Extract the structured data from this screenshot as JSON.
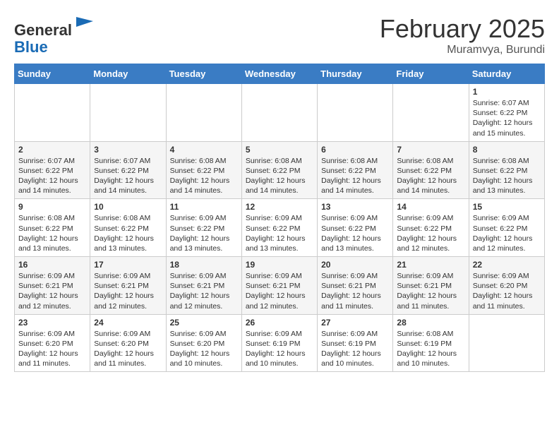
{
  "header": {
    "logo_line1": "General",
    "logo_line2": "Blue",
    "month": "February 2025",
    "location": "Muramvya, Burundi"
  },
  "weekdays": [
    "Sunday",
    "Monday",
    "Tuesday",
    "Wednesday",
    "Thursday",
    "Friday",
    "Saturday"
  ],
  "weeks": [
    [
      {
        "day": "",
        "info": ""
      },
      {
        "day": "",
        "info": ""
      },
      {
        "day": "",
        "info": ""
      },
      {
        "day": "",
        "info": ""
      },
      {
        "day": "",
        "info": ""
      },
      {
        "day": "",
        "info": ""
      },
      {
        "day": "1",
        "info": "Sunrise: 6:07 AM\nSunset: 6:22 PM\nDaylight: 12 hours\nand 15 minutes."
      }
    ],
    [
      {
        "day": "2",
        "info": "Sunrise: 6:07 AM\nSunset: 6:22 PM\nDaylight: 12 hours\nand 14 minutes."
      },
      {
        "day": "3",
        "info": "Sunrise: 6:07 AM\nSunset: 6:22 PM\nDaylight: 12 hours\nand 14 minutes."
      },
      {
        "day": "4",
        "info": "Sunrise: 6:08 AM\nSunset: 6:22 PM\nDaylight: 12 hours\nand 14 minutes."
      },
      {
        "day": "5",
        "info": "Sunrise: 6:08 AM\nSunset: 6:22 PM\nDaylight: 12 hours\nand 14 minutes."
      },
      {
        "day": "6",
        "info": "Sunrise: 6:08 AM\nSunset: 6:22 PM\nDaylight: 12 hours\nand 14 minutes."
      },
      {
        "day": "7",
        "info": "Sunrise: 6:08 AM\nSunset: 6:22 PM\nDaylight: 12 hours\nand 14 minutes."
      },
      {
        "day": "8",
        "info": "Sunrise: 6:08 AM\nSunset: 6:22 PM\nDaylight: 12 hours\nand 13 minutes."
      }
    ],
    [
      {
        "day": "9",
        "info": "Sunrise: 6:08 AM\nSunset: 6:22 PM\nDaylight: 12 hours\nand 13 minutes."
      },
      {
        "day": "10",
        "info": "Sunrise: 6:08 AM\nSunset: 6:22 PM\nDaylight: 12 hours\nand 13 minutes."
      },
      {
        "day": "11",
        "info": "Sunrise: 6:09 AM\nSunset: 6:22 PM\nDaylight: 12 hours\nand 13 minutes."
      },
      {
        "day": "12",
        "info": "Sunrise: 6:09 AM\nSunset: 6:22 PM\nDaylight: 12 hours\nand 13 minutes."
      },
      {
        "day": "13",
        "info": "Sunrise: 6:09 AM\nSunset: 6:22 PM\nDaylight: 12 hours\nand 13 minutes."
      },
      {
        "day": "14",
        "info": "Sunrise: 6:09 AM\nSunset: 6:22 PM\nDaylight: 12 hours\nand 12 minutes."
      },
      {
        "day": "15",
        "info": "Sunrise: 6:09 AM\nSunset: 6:22 PM\nDaylight: 12 hours\nand 12 minutes."
      }
    ],
    [
      {
        "day": "16",
        "info": "Sunrise: 6:09 AM\nSunset: 6:21 PM\nDaylight: 12 hours\nand 12 minutes."
      },
      {
        "day": "17",
        "info": "Sunrise: 6:09 AM\nSunset: 6:21 PM\nDaylight: 12 hours\nand 12 minutes."
      },
      {
        "day": "18",
        "info": "Sunrise: 6:09 AM\nSunset: 6:21 PM\nDaylight: 12 hours\nand 12 minutes."
      },
      {
        "day": "19",
        "info": "Sunrise: 6:09 AM\nSunset: 6:21 PM\nDaylight: 12 hours\nand 12 minutes."
      },
      {
        "day": "20",
        "info": "Sunrise: 6:09 AM\nSunset: 6:21 PM\nDaylight: 12 hours\nand 11 minutes."
      },
      {
        "day": "21",
        "info": "Sunrise: 6:09 AM\nSunset: 6:21 PM\nDaylight: 12 hours\nand 11 minutes."
      },
      {
        "day": "22",
        "info": "Sunrise: 6:09 AM\nSunset: 6:20 PM\nDaylight: 12 hours\nand 11 minutes."
      }
    ],
    [
      {
        "day": "23",
        "info": "Sunrise: 6:09 AM\nSunset: 6:20 PM\nDaylight: 12 hours\nand 11 minutes."
      },
      {
        "day": "24",
        "info": "Sunrise: 6:09 AM\nSunset: 6:20 PM\nDaylight: 12 hours\nand 11 minutes."
      },
      {
        "day": "25",
        "info": "Sunrise: 6:09 AM\nSunset: 6:20 PM\nDaylight: 12 hours\nand 10 minutes."
      },
      {
        "day": "26",
        "info": "Sunrise: 6:09 AM\nSunset: 6:19 PM\nDaylight: 12 hours\nand 10 minutes."
      },
      {
        "day": "27",
        "info": "Sunrise: 6:09 AM\nSunset: 6:19 PM\nDaylight: 12 hours\nand 10 minutes."
      },
      {
        "day": "28",
        "info": "Sunrise: 6:08 AM\nSunset: 6:19 PM\nDaylight: 12 hours\nand 10 minutes."
      },
      {
        "day": "",
        "info": ""
      }
    ]
  ]
}
